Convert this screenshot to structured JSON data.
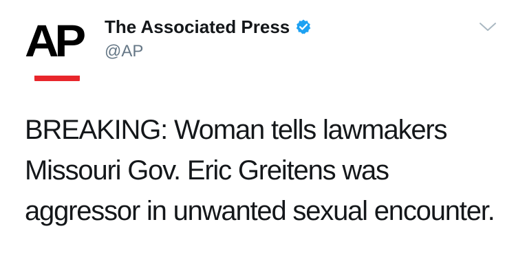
{
  "author": {
    "logo_text": "AP",
    "display_name": "The Associated Press",
    "handle": "@AP",
    "verified": true,
    "verified_icon": "verified-badge-icon"
  },
  "tweet": {
    "text": "BREAKING: Woman tells lawmakers Missouri Gov. Eric Greitens was aggressor in unwanted sexual encounter."
  },
  "menu": {
    "icon": "chevron-down-icon"
  },
  "colors": {
    "logo_red": "#e8262b",
    "verified_blue": "#1da1f2",
    "handle_gray": "#657786",
    "text": "#14171a"
  }
}
